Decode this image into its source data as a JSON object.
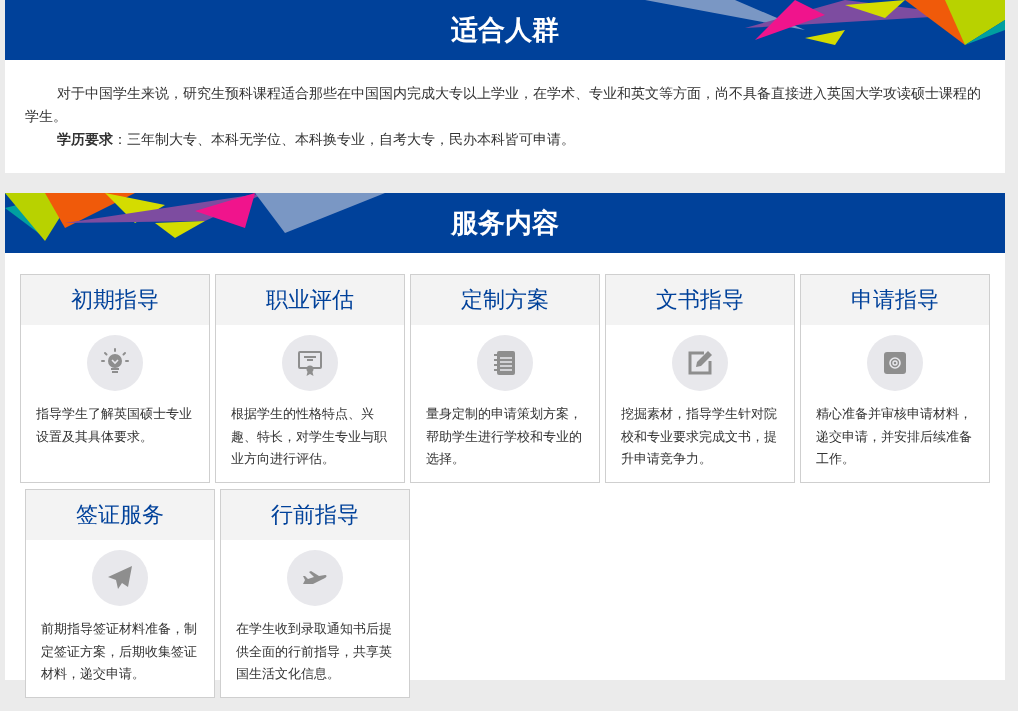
{
  "suitable_section": {
    "title": "适合人群",
    "paragraphs": [
      "对于中国学生来说，研究生预科课程适合那些在中国国内完成大专以上学业，在学术、专业和英文等方面，尚不具备直接进入英国大学攻读硕士课程的学生。",
      "**学历要求**：三年制大专、本科无学位、本科换专业，自考大专，民办本科皆可申请。"
    ]
  },
  "services_section": {
    "title": "服务内容",
    "cards": [
      {
        "title": "初期指导",
        "kind": "bulb",
        "description": "指导学生了解英国硕士专业设置及其具体要求。"
      },
      {
        "title": "职业评估",
        "kind": "certificate",
        "description": "根据学生的性格特点、兴趣、特长，对学生专业与职业方向进行评估。"
      },
      {
        "title": "定制方案",
        "kind": "notebook",
        "description": "量身定制的申请策划方案，帮助学生进行学校和专业的选择。"
      },
      {
        "title": "文书指导",
        "kind": "edit",
        "description": "挖掘素材，指导学生针对院校和专业要求完成文书，提升申请竞争力。"
      },
      {
        "title": "申请指导",
        "kind": "stamp",
        "description": "精心准备并审核申请材料，递交申请，并安排后续准备工作。"
      },
      {
        "title": "签证服务",
        "kind": "paper-plane",
        "description": "前期指导签证材料准备，制定签证方案，后期收集签证材料，递交申请。"
      },
      {
        "title": "行前指导",
        "kind": "airplane",
        "description": "在学生收到录取通知书后提供全面的行前指导，共享英国生活文化信息。"
      }
    ]
  }
}
